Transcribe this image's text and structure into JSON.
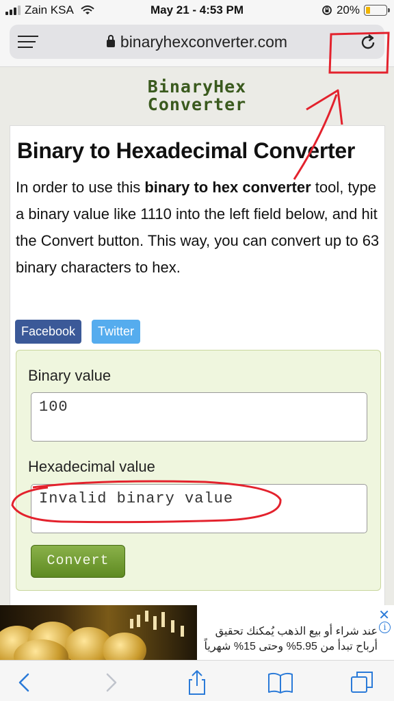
{
  "status": {
    "carrier": "Zain KSA",
    "time": "May 21 - 4:53 PM",
    "battery": "20%",
    "battery_level": 0.2
  },
  "browser": {
    "url": "binaryhexconverter.com"
  },
  "logo": {
    "line1": "BinaryHex",
    "line2": "Converter"
  },
  "page": {
    "title": "Binary to Hexadecimal Converter",
    "intro_before": "In order to use this ",
    "intro_bold": "binary to hex converter",
    "intro_after": " tool, type a binary value like 1110 into the left field below, and hit the Convert button. This way, you can convert up to 63 binary characters to hex."
  },
  "social": {
    "facebook": "Facebook",
    "twitter": "Twitter"
  },
  "form": {
    "binary_label": "Binary value",
    "binary_value": "100",
    "hex_label": "Hexadecimal value",
    "hex_value": "Invalid binary value",
    "convert_label": "Convert"
  },
  "ad": {
    "line1": "عند شراء أو بيع الذهب يُمكنك تحقيق",
    "line2": "أرباح تبدأ من 5.95% وحتى 15% شهرياً",
    "close": "✕",
    "info": "i"
  },
  "colors": {
    "accent_annotation": "#e3222d",
    "form_bg": "#eff6de",
    "convert_green": "#6f9a2e",
    "logo_green": "#3a5a1e"
  }
}
